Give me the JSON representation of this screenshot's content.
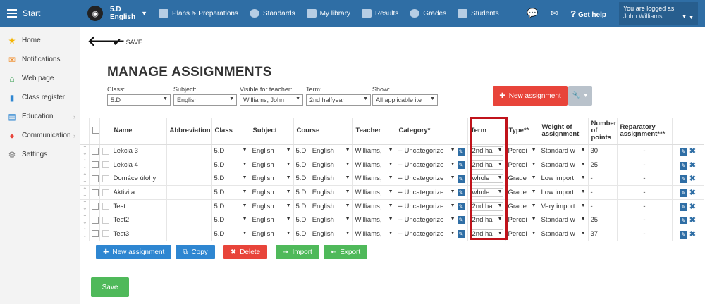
{
  "sidebar": {
    "start": "Start",
    "items": [
      {
        "label": "Home",
        "icon": "star-icon"
      },
      {
        "label": "Notifications",
        "icon": "mail-icon"
      },
      {
        "label": "Web page",
        "icon": "home-icon"
      },
      {
        "label": "Class register",
        "icon": "book-icon"
      },
      {
        "label": "Education",
        "icon": "education-icon"
      },
      {
        "label": "Communication",
        "icon": "chat-icon"
      },
      {
        "label": "Settings",
        "icon": "gear-icon"
      }
    ]
  },
  "topbar": {
    "class_line1": "5.D",
    "class_line2": "English",
    "nav": [
      "Plans & Preparations",
      "Standards",
      "My library",
      "Results",
      "Grades",
      "Students"
    ],
    "help": "Get help",
    "user_line1": "You are logged as",
    "user_line2": "John Williams"
  },
  "toolbar": {
    "save": "SAVE"
  },
  "page": {
    "title": "MANAGE ASSIGNMENTS"
  },
  "filters": {
    "class_label": "Class:",
    "class_value": "5.D",
    "subject_label": "Subject:",
    "subject_value": "English",
    "teacher_label": "Visible for teacher:",
    "teacher_value": "Williams, John",
    "term_label": "Term:",
    "term_value": "2nd halfyear",
    "show_label": "Show:",
    "show_value": "All applicable ite"
  },
  "buttons": {
    "new_assignment": "New assignment",
    "new_assignment2": "New assignment",
    "copy": "Copy",
    "delete": "Delete",
    "import": "Import",
    "export": "Export",
    "save": "Save"
  },
  "table": {
    "headers": {
      "name": "Name",
      "abbr": "Abbreviation",
      "class": "Class",
      "subject": "Subject",
      "course": "Course",
      "teacher": "Teacher",
      "category": "Category*",
      "term": "Term",
      "type": "Type**",
      "weight": "Weight of assignment",
      "points": "Number of points",
      "reparatory": "Reparatory assignment***"
    },
    "rows": [
      {
        "name": "Lekcia 3",
        "abbr": "",
        "class": "5.D",
        "subject": "English",
        "course": "5.D · English",
        "teacher": "Williams,",
        "category": "-- Uncategorize",
        "term": "2nd ha",
        "type": "Percei",
        "weight": "Standard w",
        "points": "30",
        "rep": "-"
      },
      {
        "name": "Lekcia 4",
        "abbr": "",
        "class": "5.D",
        "subject": "English",
        "course": "5.D · English",
        "teacher": "Williams,",
        "category": "-- Uncategorize",
        "term": "2nd ha",
        "type": "Percei",
        "weight": "Standard w",
        "points": "25",
        "rep": "-"
      },
      {
        "name": "Domáce úlohy",
        "abbr": "",
        "class": "5.D",
        "subject": "English",
        "course": "5.D · English",
        "teacher": "Williams,",
        "category": "-- Uncategorize",
        "term": "whole",
        "type": "Grade",
        "weight": "Low import",
        "points": "-",
        "rep": "-"
      },
      {
        "name": "Aktivita",
        "abbr": "",
        "class": "5.D",
        "subject": "English",
        "course": "5.D · English",
        "teacher": "Williams,",
        "category": "-- Uncategorize",
        "term": "whole",
        "type": "Grade",
        "weight": "Low import",
        "points": "-",
        "rep": "-"
      },
      {
        "name": "Test",
        "abbr": "",
        "class": "5.D",
        "subject": "English",
        "course": "5.D · English",
        "teacher": "Williams,",
        "category": "-- Uncategorize",
        "term": "2nd ha",
        "type": "Grade",
        "weight": "Very import",
        "points": "-",
        "rep": "-"
      },
      {
        "name": "Test2",
        "abbr": "",
        "class": "5.D",
        "subject": "English",
        "course": "5.D · English",
        "teacher": "Williams,",
        "category": "-- Uncategorize",
        "term": "2nd ha",
        "type": "Percei",
        "weight": "Standard w",
        "points": "25",
        "rep": "-"
      },
      {
        "name": "Test3",
        "abbr": "",
        "class": "5.D",
        "subject": "English",
        "course": "5.D · English",
        "teacher": "Williams,",
        "category": "-- Uncategorize",
        "term": "2nd ha",
        "type": "Percei",
        "weight": "Standard w",
        "points": "37",
        "rep": "-"
      }
    ]
  }
}
